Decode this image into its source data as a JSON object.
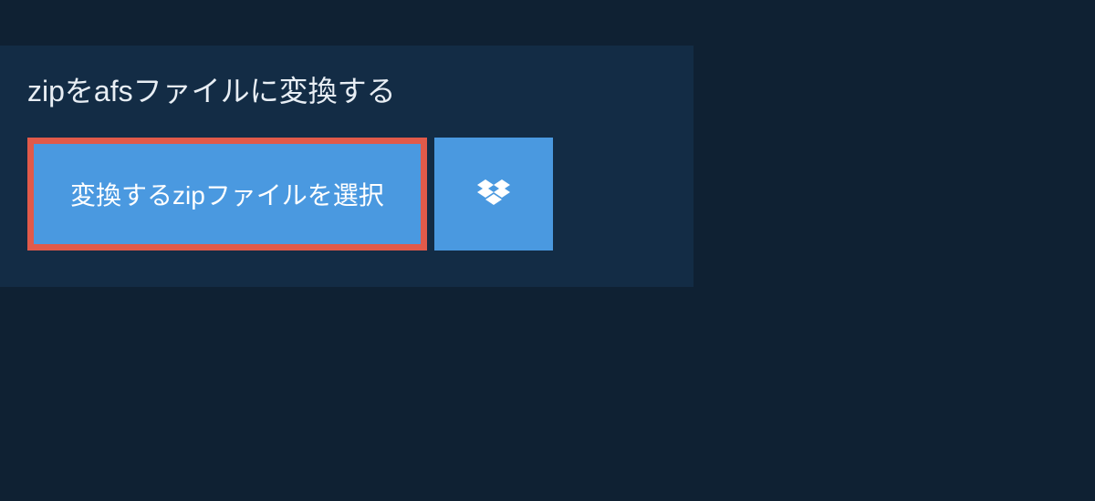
{
  "title": "zipをafsファイルに変換する",
  "select_button_label": "変換するzipファイルを選択"
}
